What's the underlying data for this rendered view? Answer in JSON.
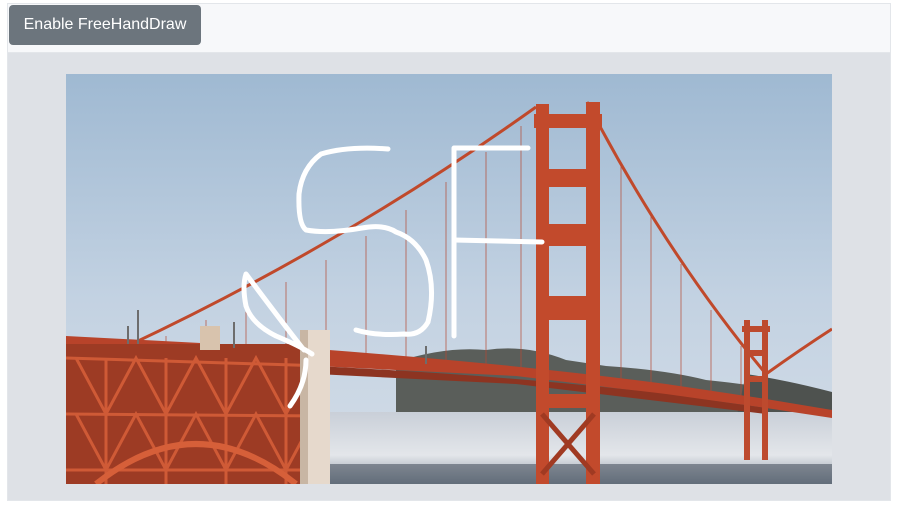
{
  "toolbar": {
    "freehand_button_label": "Enable FreeHandDraw"
  },
  "canvas": {
    "image_subject": "Golden Gate Bridge photo with freehand drawing overlay",
    "drawing_color": "#ffffff",
    "sky_color": "#a9c1d8",
    "bridge_color": "#c0492b",
    "fog_color": "#d9dde3"
  },
  "colors": {
    "toolbar_background": "#f7f8fa",
    "button_background": "#6c757d",
    "canvas_background": "#dee1e6"
  }
}
